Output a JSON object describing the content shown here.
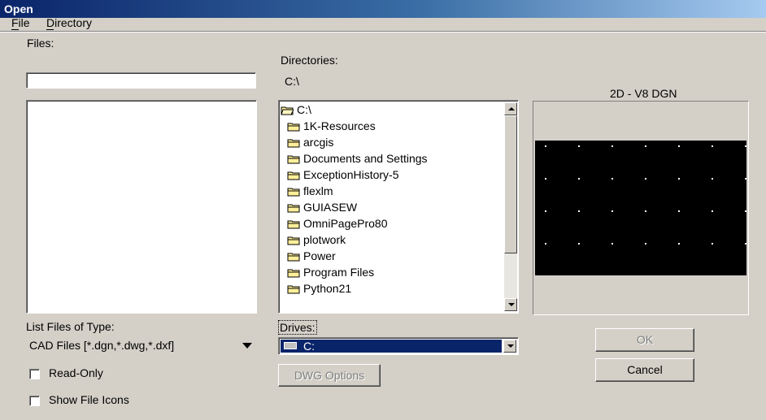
{
  "window": {
    "title": "Open"
  },
  "menu": {
    "file_label": "File",
    "directory_label": "Directory"
  },
  "files": {
    "label": "Files:",
    "input_value": ""
  },
  "directories": {
    "label": "Directories:",
    "current_path": "C:\\",
    "items": [
      {
        "name": "C:\\",
        "open": true
      },
      {
        "name": "1K-Resources",
        "open": false
      },
      {
        "name": "arcgis",
        "open": false
      },
      {
        "name": "Documents and Settings",
        "open": false
      },
      {
        "name": "ExceptionHistory-5",
        "open": false
      },
      {
        "name": "flexlm",
        "open": false
      },
      {
        "name": "GUIASEW",
        "open": false
      },
      {
        "name": "OmniPagePro80",
        "open": false
      },
      {
        "name": "plotwork",
        "open": false
      },
      {
        "name": "Power",
        "open": false
      },
      {
        "name": "Program Files",
        "open": false
      },
      {
        "name": "Python21",
        "open": false
      }
    ]
  },
  "preview": {
    "title": "2D - V8 DGN"
  },
  "file_type": {
    "label": "List Files of Type:",
    "selected": "CAD Files [*.dgn,*.dwg,*.dxf]"
  },
  "drives": {
    "label": "Drives:",
    "selected": "C:"
  },
  "buttons": {
    "dwg_options": "DWG Options",
    "ok": "OK",
    "cancel": "Cancel"
  },
  "options": {
    "read_only": "Read-Only",
    "show_file_icons": "Show File Icons"
  },
  "colors": {
    "title_start": "#0a246a",
    "selection": "#0a246a",
    "preview_bg": "#000000"
  }
}
